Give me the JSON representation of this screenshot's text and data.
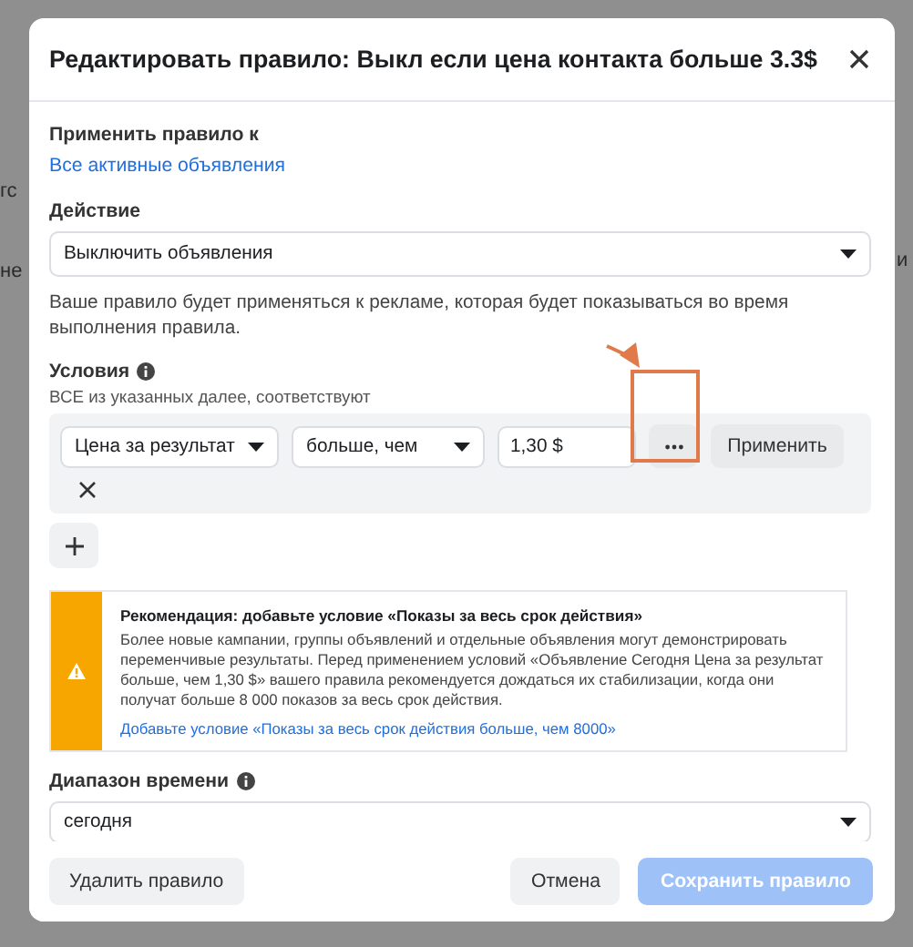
{
  "backdrop": {
    "left_fragments": [
      "гс",
      "не"
    ],
    "right_fragments": [
      "и"
    ]
  },
  "dialog": {
    "title": "Редактировать правило: Выкл если цена контакта больше 3.3$",
    "apply_to": {
      "label": "Применить правило к",
      "value": "Все активные объявления"
    },
    "action": {
      "label": "Действие",
      "value": "Выключить объявления",
      "note": "Ваше правило будет применяться к рекламе, которая будет показываться во время выполнения правила."
    },
    "conditions": {
      "label": "Условия",
      "subtitle": "ВСЕ из указанных далее, соответствуют",
      "rows": [
        {
          "metric": "Цена за результат",
          "operator": "больше, чем",
          "value": "1,30 $",
          "apply_button": "Применить"
        }
      ]
    },
    "recommendation": {
      "title": "Рекомендация: добавьте условие «Показы за весь срок действия»",
      "body": "Более новые кампании, группы объявлений и отдельные объявления могут демонстрировать переменчивые результаты. Перед применением условий «Объявление Сегодня Цена за результат больше, чем 1,30 $» вашего правила рекомендуется дождаться их стабилизации, когда они получат больше 8 000 показов за весь срок действия.",
      "link": "Добавьте условие «Показы за весь срок действия больше, чем 8000»"
    },
    "time_range": {
      "label": "Диапазон времени",
      "value": "сегодня"
    },
    "footer": {
      "delete": "Удалить правило",
      "cancel": "Отмена",
      "save": {
        "label": "Сохранить правило",
        "disabled": true
      }
    }
  }
}
